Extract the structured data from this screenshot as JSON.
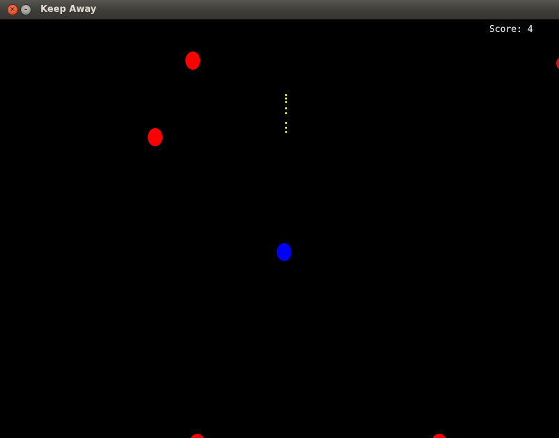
{
  "window": {
    "title": "Keep Away",
    "close_icon": "close-icon",
    "minimize_icon": "minimize-icon"
  },
  "hud": {
    "score_text": "Score: 4"
  },
  "colors": {
    "background": "#000000",
    "enemy": "#ff0000",
    "player": "#0000ff",
    "bullet": "#ffff00",
    "text": "#ffffff"
  }
}
